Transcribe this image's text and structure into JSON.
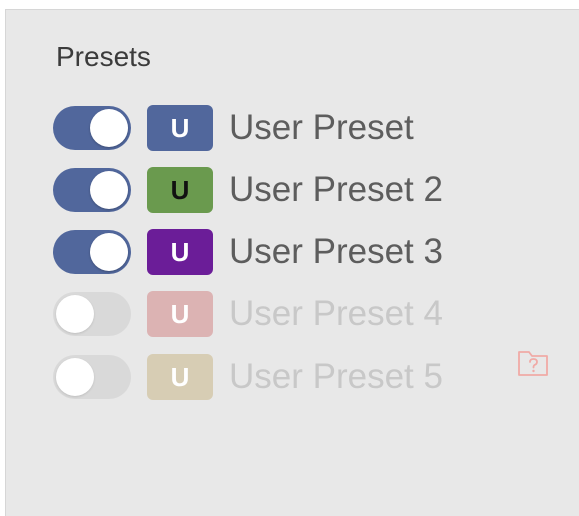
{
  "panel": {
    "title": "Presets"
  },
  "presets": [
    {
      "label": "User Preset",
      "badge_letter": "U",
      "enabled": true,
      "badge_color": "#51679c",
      "badge_text_color": "#ffffff"
    },
    {
      "label": "User Preset 2",
      "badge_letter": "U",
      "enabled": true,
      "badge_color": "#6a9a4e",
      "badge_text_color": "#111111"
    },
    {
      "label": "User Preset 3",
      "badge_letter": "U",
      "enabled": true,
      "badge_color": "#6b1d98",
      "badge_text_color": "#ffffff"
    },
    {
      "label": "User Preset 4",
      "badge_letter": "U",
      "enabled": false,
      "badge_color": "#dcb3b3",
      "badge_text_color": "#ffffff"
    },
    {
      "label": "User Preset 5",
      "badge_letter": "U",
      "enabled": false,
      "badge_color": "#d7cdb4",
      "badge_text_color": "#ffffff"
    }
  ],
  "icons": {
    "missing_folder": "folder-question-icon",
    "missing_folder_color": "#f0aaa6"
  },
  "colors": {
    "toggle_on": "#51679c",
    "toggle_off": "#d9d9d9",
    "panel_bg": "#e8e8e8"
  }
}
